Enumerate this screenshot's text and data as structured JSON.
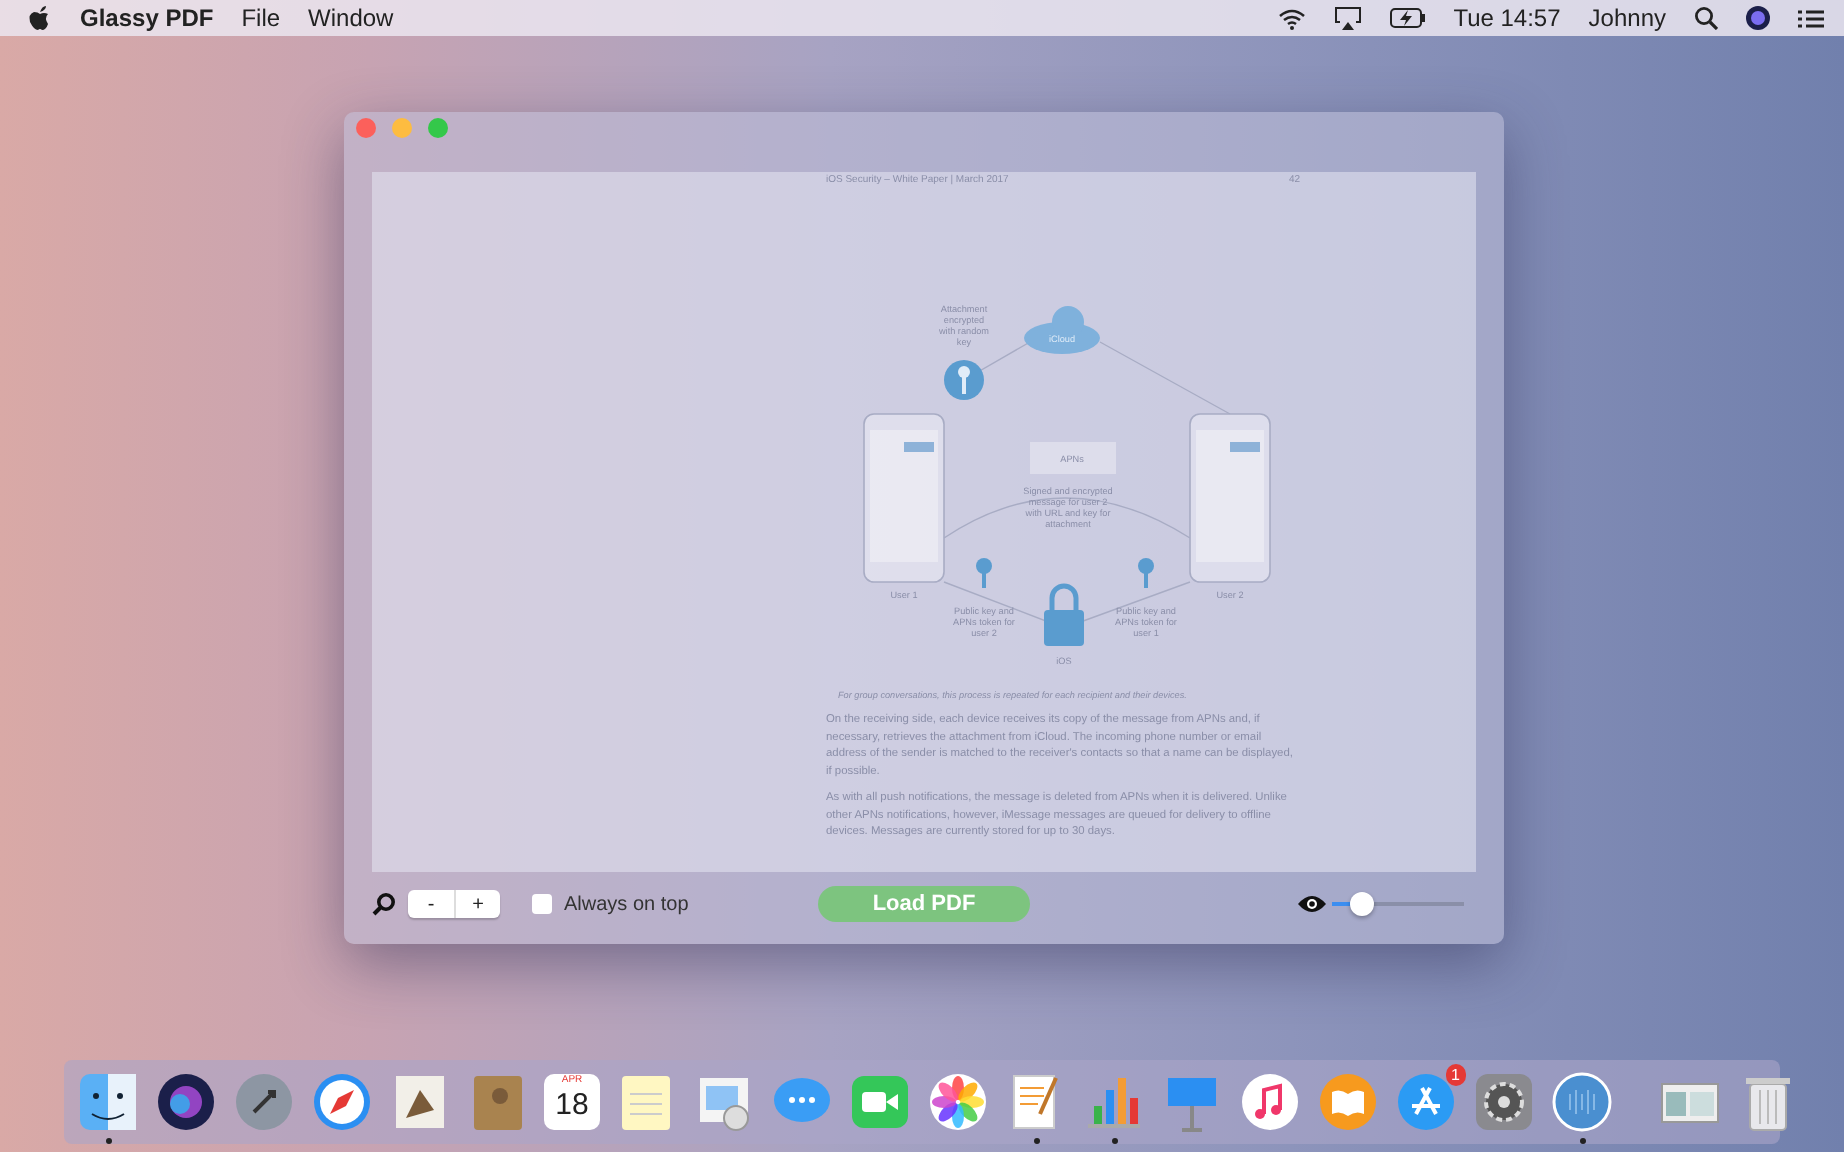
{
  "menubar": {
    "app_name": "Glassy PDF",
    "menus": [
      "File",
      "Window"
    ],
    "clock": "Tue 14:57",
    "user": "Johnny"
  },
  "window": {
    "document": {
      "header": "iOS Security – White Paper | March 2017",
      "page_number": "42",
      "figure": {
        "cloud": "iCloud",
        "attachment": "Attachment encrypted with random key",
        "apns": "APNs",
        "message": "Signed and encrypted message for user 2 with URL and key for attachment",
        "user_left": "User 1",
        "user_right": "User 2",
        "key_left": "Public key and APNs token for user 2",
        "key_right": "Public key and APNs token for user 1",
        "lock": "iOS"
      },
      "caption": "For group conversations, this process is repeated for each recipient and their devices.",
      "paragraphs": [
        "On the receiving side, each device receives its copy of the message from APNs and, if necessary, retrieves the attachment from iCloud. The incoming phone number or email address of the sender is matched to the receiver's contacts so that a name can be displayed, if possible.",
        "As with all push notifications, the message is deleted from APNs when it is delivered. Unlike other APNs notifications, however, iMessage messages are queued for delivery to offline devices. Messages are currently stored for up to 30 days."
      ]
    },
    "controls": {
      "zoom_out": "-",
      "zoom_in": "+",
      "always_on_top": {
        "label": "Always on top",
        "checked": false
      },
      "load_button": "Load PDF",
      "opacity": {
        "level": 0.23
      }
    }
  },
  "dock": {
    "apps": [
      {
        "kind": "finder",
        "running": true
      },
      {
        "kind": "siri",
        "running": false
      },
      {
        "kind": "launchpad",
        "running": false
      },
      {
        "kind": "safari",
        "running": false
      },
      {
        "kind": "mail",
        "running": false
      },
      {
        "kind": "contacts",
        "running": false
      },
      {
        "kind": "calendar",
        "running": false,
        "month": "APR",
        "day": "18"
      },
      {
        "kind": "notes",
        "running": false
      },
      {
        "kind": "preview",
        "running": false
      },
      {
        "kind": "messages",
        "running": false
      },
      {
        "kind": "facetime",
        "running": false
      },
      {
        "kind": "photos",
        "running": false
      },
      {
        "kind": "pages",
        "running": true
      },
      {
        "kind": "numbers",
        "running": true
      },
      {
        "kind": "keynote",
        "running": false
      },
      {
        "kind": "itunes",
        "running": false
      },
      {
        "kind": "ibooks",
        "running": false
      },
      {
        "kind": "appstore",
        "running": false,
        "badge": "1"
      },
      {
        "kind": "preferences",
        "running": false
      },
      {
        "kind": "blueapp",
        "running": true
      }
    ],
    "others": [
      {
        "kind": "window"
      },
      {
        "kind": "trash"
      }
    ]
  }
}
